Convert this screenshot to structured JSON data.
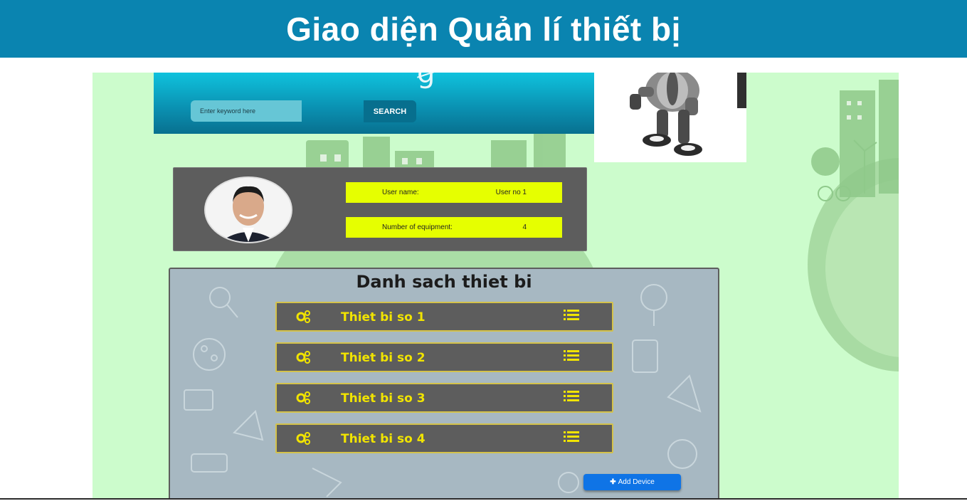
{
  "banner": {
    "title": "Giao diện Quản lí thiết bị"
  },
  "search": {
    "placeholder": "Enter keyword here",
    "button_label": "SEARCH"
  },
  "user": {
    "username_label": "User name:",
    "username_value": "User no 1",
    "equipment_label": "Number of equipment:",
    "equipment_value": "4"
  },
  "devices": {
    "title": "Danh sach thiet bi",
    "items": [
      {
        "label": "Thiet bi so 1",
        "icon": "gears-icon",
        "action_icon": "list-icon"
      },
      {
        "label": "Thiet bi so 2",
        "icon": "gears-icon",
        "action_icon": "list-icon"
      },
      {
        "label": "Thiet bi so 3",
        "icon": "gears-icon",
        "action_icon": "list-icon"
      },
      {
        "label": "Thiet bi so 4",
        "icon": "gears-icon",
        "action_icon": "list-icon"
      }
    ],
    "add_label": "Add Device"
  },
  "colors": {
    "banner": "#0a84b0",
    "background": "#ccfccc",
    "card": "#5d5d5d",
    "highlight": "#e6ff00",
    "device_text": "#f1e400",
    "add_button": "#0f74e6"
  }
}
